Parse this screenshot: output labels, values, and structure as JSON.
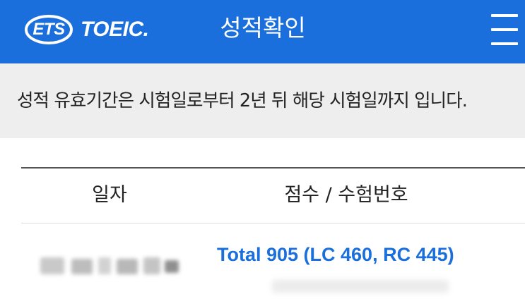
{
  "header": {
    "logo_ets": "ETS",
    "logo_toeic": "TOEIC.",
    "title": "성적확인",
    "menu_icon": "hamburger-menu-icon"
  },
  "notice": {
    "text": "성적 유효기간은 시험일로부터 2년 뒤 해당 시험일까지 입니다."
  },
  "table": {
    "columns": [
      "일자",
      "점수 / 수험번호"
    ],
    "rows": [
      {
        "score": "Total 905 (LC 460, RC 445)"
      }
    ]
  },
  "colors": {
    "brand_blue": "#1a6fdc",
    "notice_bg": "#eeeeee",
    "text": "#222222"
  }
}
